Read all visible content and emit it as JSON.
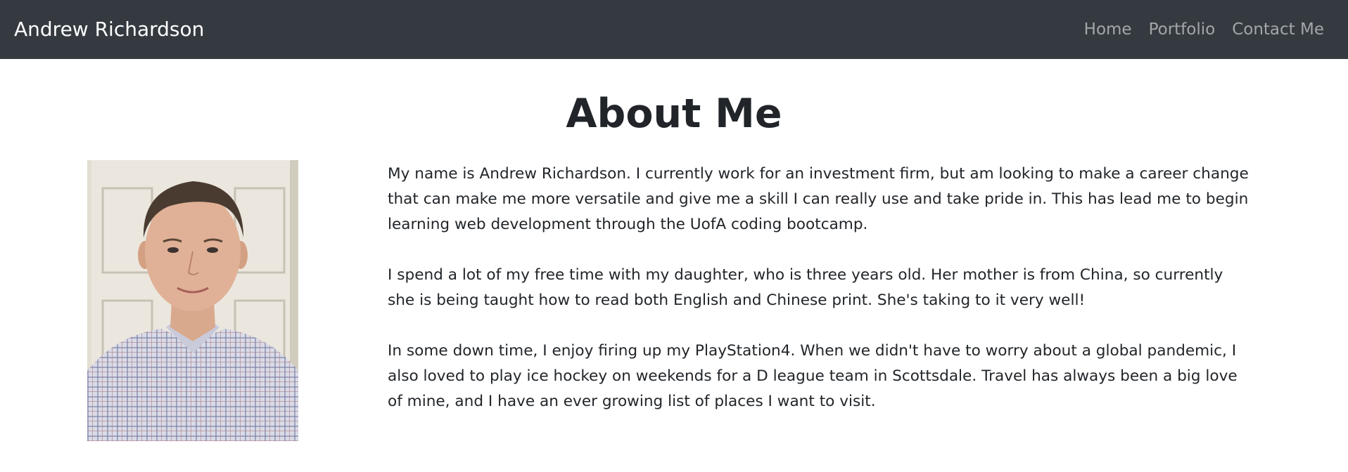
{
  "navbar": {
    "brand": "Andrew Richardson",
    "links": [
      {
        "label": "Home"
      },
      {
        "label": "Portfolio"
      },
      {
        "label": "Contact Me"
      }
    ],
    "background": "#343a40"
  },
  "main": {
    "title": "About Me",
    "paragraphs": [
      "My name is Andrew Richardson. I currently work for an investment firm, but am looking to make a career change that can make me more versatile and give me a skill I can really use and take pride in. This has lead me to begin learning web development through the UofA coding bootcamp.",
      "I spend a lot of my free time with my daughter, who is three years old. Her mother is from China, so currently she is being taught how to read both English and Chinese print. She's taking to it very well!",
      "In some down time, I enjoy firing up my PlayStation4. When we didn't have to worry about a global pandemic, I also loved to play ice hockey on weekends for a D league team in Scottsdale. Travel has always been a big love of mine, and I have an ever growing list of places I want to visit."
    ]
  }
}
